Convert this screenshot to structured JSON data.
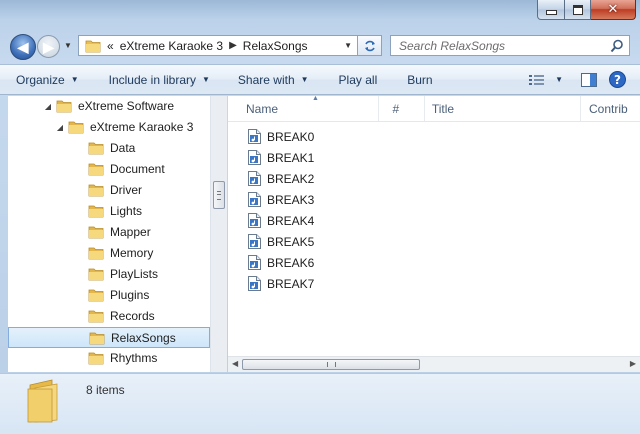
{
  "window": {
    "caption_buttons": [
      "minimize",
      "maximize",
      "close"
    ]
  },
  "address_bar": {
    "overflow_marker": "«",
    "breadcrumbs": [
      "eXtreme Karaoke 3",
      "RelaxSongs"
    ]
  },
  "search": {
    "placeholder": "Search RelaxSongs"
  },
  "toolbar": {
    "organize": "Organize",
    "include_in_library": "Include in library",
    "share_with": "Share with",
    "play_all": "Play all",
    "burn": "Burn"
  },
  "nav_tree": {
    "items": [
      {
        "label": "eXtreme Software",
        "level": 0,
        "expanded": true
      },
      {
        "label": "eXtreme Karaoke 3",
        "level": 1,
        "expanded": true
      },
      {
        "label": "Data",
        "level": 2
      },
      {
        "label": "Document",
        "level": 2
      },
      {
        "label": "Driver",
        "level": 2
      },
      {
        "label": "Lights",
        "level": 2
      },
      {
        "label": "Mapper",
        "level": 2
      },
      {
        "label": "Memory",
        "level": 2
      },
      {
        "label": "PlayLists",
        "level": 2
      },
      {
        "label": "Plugins",
        "level": 2
      },
      {
        "label": "Records",
        "level": 2
      },
      {
        "label": "RelaxSongs",
        "level": 2,
        "selected": true
      },
      {
        "label": "Rhythms",
        "level": 2
      }
    ]
  },
  "columns": {
    "name": "Name",
    "number": "#",
    "title": "Title",
    "contributing": "Contrib"
  },
  "files": [
    "BREAK0",
    "BREAK1",
    "BREAK2",
    "BREAK3",
    "BREAK4",
    "BREAK5",
    "BREAK6",
    "BREAK7"
  ],
  "details": {
    "item_count": "8 items"
  },
  "colors": {
    "selection_fill": "#cde6fa",
    "selection_border": "#84acdd",
    "folder_yellow": "#f1d074",
    "toolbar_text": "#1e395b"
  },
  "icons": {
    "folder": "folder-icon",
    "audio_file": "audio-file-icon",
    "search": "search-icon",
    "refresh": "refresh-icon",
    "view": "view-options-icon",
    "preview": "preview-pane-icon",
    "help": "help-icon"
  }
}
